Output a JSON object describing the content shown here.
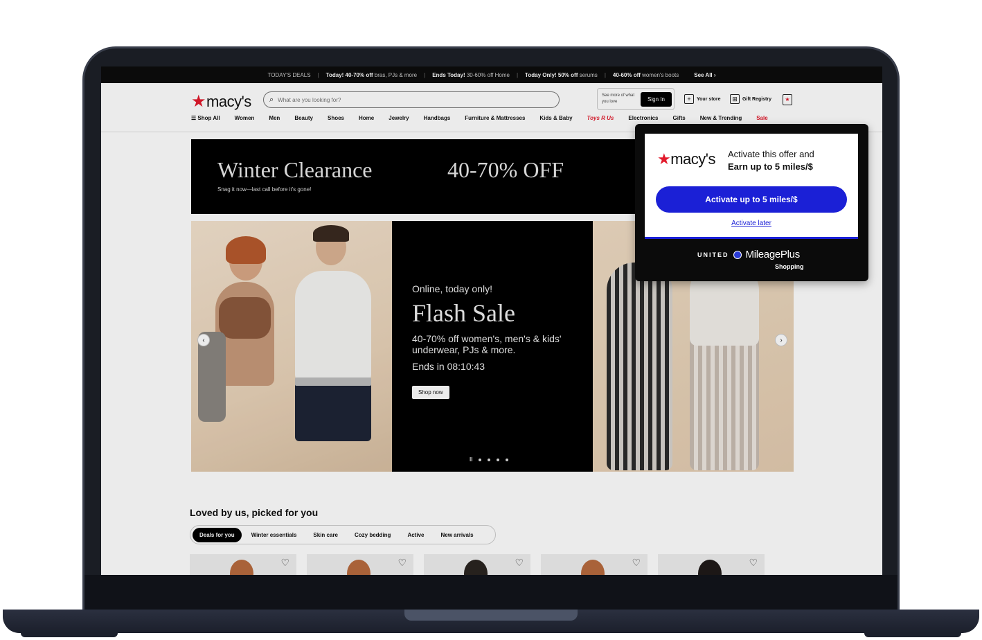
{
  "promo": {
    "label": "TODAY'S DEALS",
    "items": [
      {
        "bold": "Today! 40-70% off",
        "rest": " bras, PJs & more"
      },
      {
        "bold": "Ends Today!",
        "rest": " 30-60% off Home"
      },
      {
        "bold": "Today Only! 50% off",
        "rest": " serums"
      },
      {
        "bold": "40-60% off",
        "rest": " women's boots"
      }
    ],
    "see_all": "See All ›"
  },
  "header": {
    "logo_text": "macy's",
    "search_placeholder": "What are you looking for?",
    "signin_hint": "See more of what you love",
    "signin_label": "Sign In",
    "store_label": "Your store",
    "registry_label": "Gift Registry"
  },
  "nav": {
    "shop_all": "Shop All",
    "items": [
      "Women",
      "Men",
      "Beauty",
      "Shoes",
      "Home",
      "Jewelry",
      "Handbags",
      "Furniture & Mattresses",
      "Kids & Baby"
    ],
    "toys": "Toys R Us",
    "items2": [
      "Electronics",
      "Gifts",
      "New & Trending"
    ],
    "sale": "Sale"
  },
  "winter": {
    "title": "Winter Clearance",
    "subtitle": "Snag it now—last call before it's gone!",
    "offer": "40-70% OFF"
  },
  "hero": {
    "kicker": "Online, today only!",
    "title": "Flash Sale",
    "desc": "40-70% off women's, men's & kids' underwear, PJs & more.",
    "timer": "Ends in 08:10:43",
    "cta": "Shop now"
  },
  "loved": {
    "title": "Loved by us, picked for you",
    "chips": [
      "Deals for you",
      "Winter essentials",
      "Skin care",
      "Cozy bedding",
      "Active",
      "New arrivals"
    ]
  },
  "popup": {
    "logo_text": "macy's",
    "line1": "Activate this offer and",
    "line2": "Earn up to 5 miles/$",
    "button": "Activate up to 5 miles/$",
    "later": "Activate later",
    "brand1": "UNITED",
    "brand2": "MileagePlus",
    "brand3": "Shopping"
  },
  "colors": {
    "accent": "#1b20d6",
    "brand_red": "#e21a2c"
  }
}
